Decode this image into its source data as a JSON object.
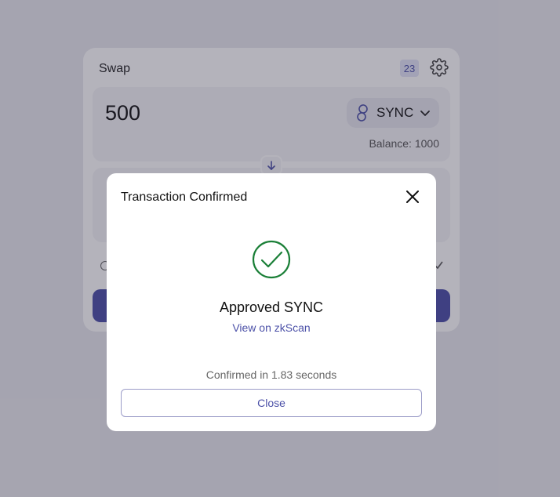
{
  "swap_card": {
    "title": "Swap",
    "nonce_badge": "23",
    "input": {
      "amount": "500",
      "token": "SYNC",
      "balance": "Balance: 1000"
    }
  },
  "modal": {
    "title": "Transaction Confirmed",
    "status": "Approved SYNC",
    "link": "View on zkScan",
    "confirm_time": "Confirmed in 1.83 seconds",
    "close_label": "Close"
  },
  "colors": {
    "accent": "#4c51a8",
    "success": "#1a7f37"
  },
  "icons": {
    "settings": "gear-icon",
    "token": "sync-token-icon",
    "chevron": "chevron-down-icon",
    "arrow": "arrow-down-icon",
    "close": "close-icon",
    "success": "check-circle-icon"
  }
}
